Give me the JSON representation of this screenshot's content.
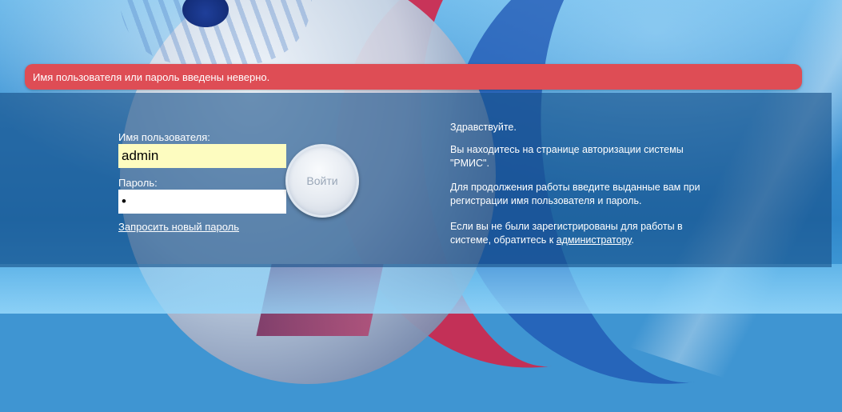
{
  "error": {
    "message": "Имя пользователя или пароль введены неверно."
  },
  "login_form": {
    "username_label": "Имя пользователя:",
    "username_value": "admin",
    "password_label": "Пароль:",
    "password_value": "•",
    "submit_label": "Войти",
    "reset_link": "Запросить новый пароль"
  },
  "info": {
    "greeting": "Здравствуйте.",
    "line1_a": "Вы находитесь на странице авторизации системы",
    "line1_b": "\"РМИС\".",
    "line2_a": "Для продолжения работы введите выданные вам при",
    "line2_b": "регистрации имя пользователя и пароль.",
    "line3_a": "Если вы не были зарегистрированы для работы в",
    "line3_b_prefix": "системе, обратитесь к ",
    "admin_link": "администратору",
    "line3_b_suffix": "."
  },
  "colors": {
    "error_banner": "#de4d55",
    "username_field": "#fdfcc0",
    "panel": "#174f88"
  }
}
